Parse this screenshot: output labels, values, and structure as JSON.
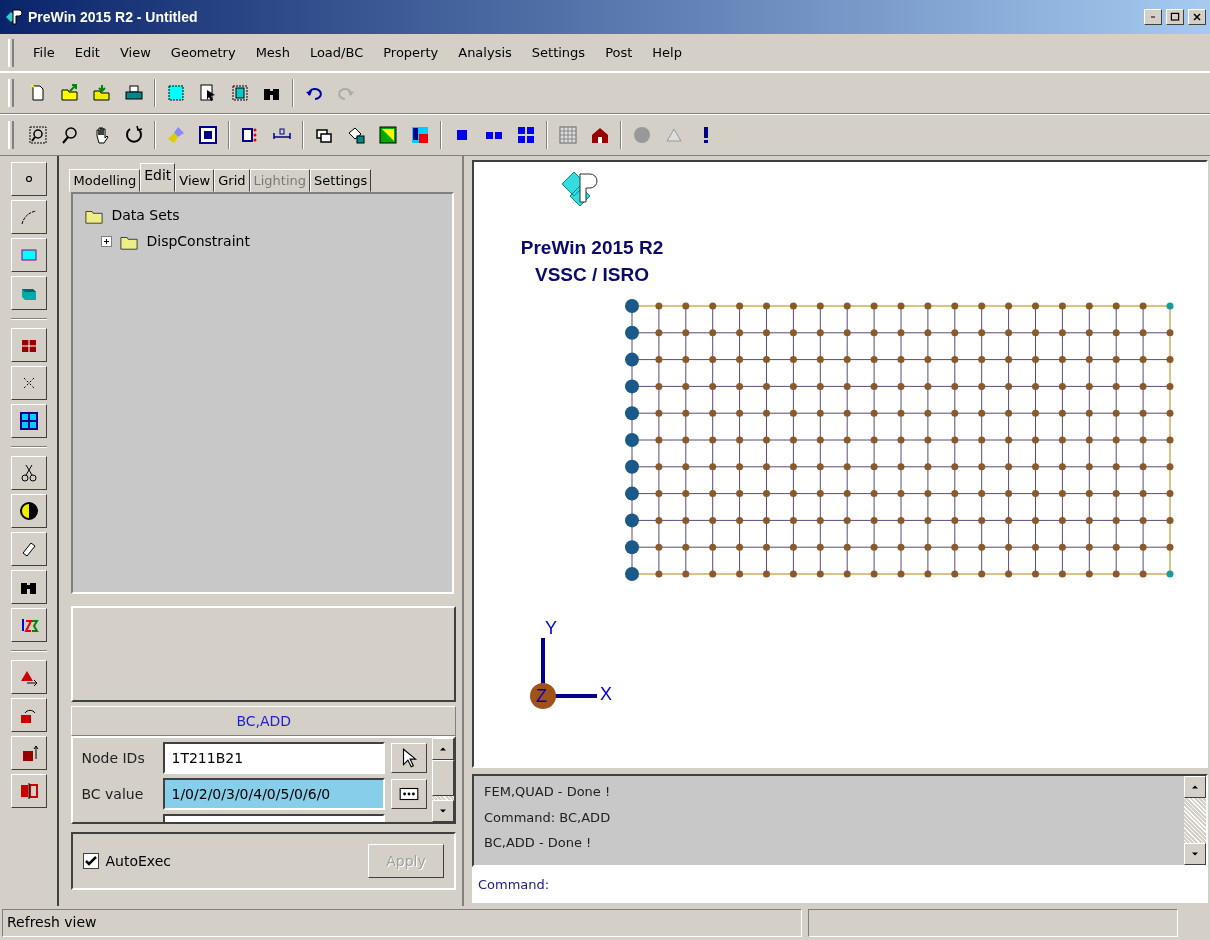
{
  "window": {
    "title": "PreWin 2015 R2 - Untitled"
  },
  "menu": [
    {
      "label": "File"
    },
    {
      "label": "Edit"
    },
    {
      "label": "View"
    },
    {
      "label": "Geometry"
    },
    {
      "label": "Mesh"
    },
    {
      "label": "Load/BC"
    },
    {
      "label": "Property"
    },
    {
      "label": "Analysis"
    },
    {
      "label": "Settings"
    },
    {
      "label": "Post"
    },
    {
      "label": "Help"
    }
  ],
  "tabs": [
    {
      "label": "Modelling",
      "selected": false,
      "disabled": false
    },
    {
      "label": "Edit",
      "selected": true,
      "disabled": false
    },
    {
      "label": "View",
      "selected": false,
      "disabled": false
    },
    {
      "label": "Grid",
      "selected": false,
      "disabled": false
    },
    {
      "label": "Lighting",
      "selected": false,
      "disabled": true
    },
    {
      "label": "Settings",
      "selected": false,
      "disabled": false
    }
  ],
  "tree": [
    {
      "label": "Data Sets",
      "children": [
        {
          "label": "DispConstraint",
          "expanded": false
        }
      ]
    }
  ],
  "form": {
    "title": "BC,ADD",
    "fields": [
      {
        "label": "Node IDs",
        "value": "1T211B21",
        "kind": "pick",
        "highlighted": false
      },
      {
        "label": "BC value",
        "value": "1/0/2/0/3/0/4/0/5/0/6/0",
        "kind": "browse",
        "highlighted": true
      }
    ]
  },
  "autoexec": {
    "label": "AutoExec",
    "checked": true
  },
  "apply_button": {
    "label": "Apply",
    "disabled": true
  },
  "viewport": {
    "logo_lines": [
      "PreWin 2015 R2",
      "VSSC / ISRO"
    ],
    "axes": {
      "y": "Y",
      "z": "Z",
      "x": "X"
    }
  },
  "messages": [
    "FEM,QUAD - Done !",
    "Command: BC,ADD",
    "BC,ADD - Done !"
  ],
  "command": {
    "label": "Command:"
  },
  "status_bar": [
    "Refresh view"
  ]
}
